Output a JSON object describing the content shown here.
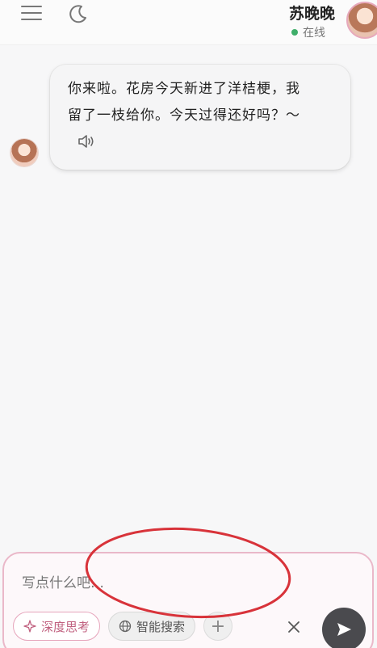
{
  "header": {
    "contact_name": "苏晚晚",
    "status": "在线",
    "status_color": "#3fae6a"
  },
  "icons": {
    "menu": "menu-icon",
    "theme": "moon-icon",
    "avatar": "avatar",
    "speaker": "speaker-icon",
    "deep_think": "sparkle-icon",
    "web_search": "globe-icon",
    "add": "plus-icon",
    "close": "close-icon",
    "send": "send-icon"
  },
  "messages": [
    {
      "sender": "苏晚晚",
      "text_line1": "你来啦。花房今天新进了洋桔梗，我",
      "text_line2": "留了一枝给你。今天过得还好吗？～"
    }
  ],
  "composer": {
    "placeholder": "写点什么吧…",
    "deep_think_label": "深度思考",
    "web_search_label": "智能搜索",
    "add_label": "+",
    "accent_color": "#e6a4bb",
    "send_color": "#4a4a4e"
  },
  "annotation": {
    "shape": "ellipse",
    "color": "#d8333a"
  }
}
